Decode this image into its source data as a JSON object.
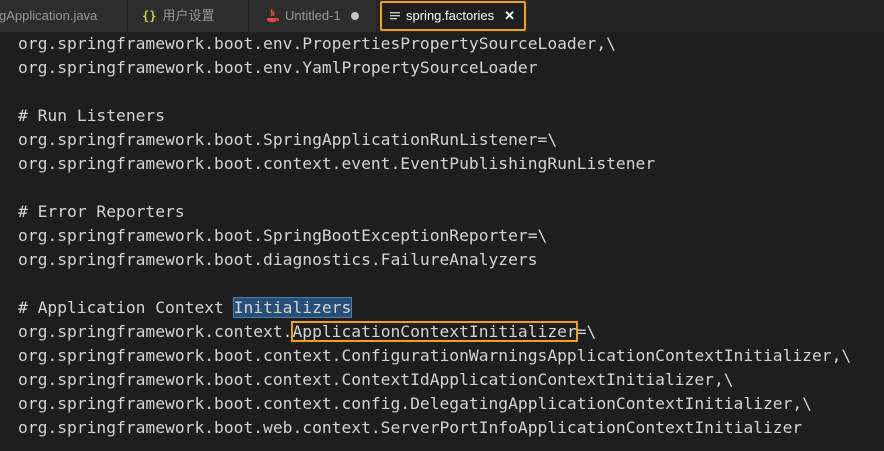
{
  "tabs": [
    {
      "label": "gApplication.java",
      "icon": "none"
    },
    {
      "label": "用户设置",
      "icon": "braces-icon",
      "glyph": "{}"
    },
    {
      "label": "Untitled-1",
      "icon": "java-icon",
      "dirty": true
    },
    {
      "label": "spring.factories",
      "icon": "lines-icon",
      "active": true,
      "close_glyph": "✕"
    }
  ],
  "editor": {
    "lines": [
      {
        "text": "org.springframework.boot.env.PropertiesPropertySourceLoader,\\"
      },
      {
        "text": "org.springframework.boot.env.YamlPropertySourceLoader"
      },
      {
        "text": ""
      },
      {
        "text": "# Run Listeners"
      },
      {
        "text": "org.springframework.boot.SpringApplicationRunListener=\\"
      },
      {
        "text": "org.springframework.boot.context.event.EventPublishingRunListener"
      },
      {
        "text": ""
      },
      {
        "text": "# Error Reporters"
      },
      {
        "text": "org.springframework.boot.SpringBootExceptionReporter=\\"
      },
      {
        "text": "org.springframework.boot.diagnostics.FailureAnalyzers"
      },
      {
        "text": ""
      },
      {
        "pre": "# Application Context ",
        "mark": "Initializers",
        "post": ""
      },
      {
        "pre": "org.springframework.context.",
        "mark": "ApplicationContextInitializer",
        "post": "=\\"
      },
      {
        "text": "org.springframework.boot.context.ConfigurationWarningsApplicationContextInitializer,\\"
      },
      {
        "text": "org.springframework.boot.context.ContextIdApplicationContextInitializer,\\"
      },
      {
        "text": "org.springframework.boot.context.config.DelegatingApplicationContextInitializer,\\"
      },
      {
        "text": "org.springframework.boot.web.context.ServerPortInfoApplicationContextInitializer"
      }
    ]
  },
  "colors": {
    "accent_box": "#f0a30a",
    "selection": "#264f78",
    "editor_bg": "#1e1e1e",
    "text": "#d4d4d4"
  }
}
